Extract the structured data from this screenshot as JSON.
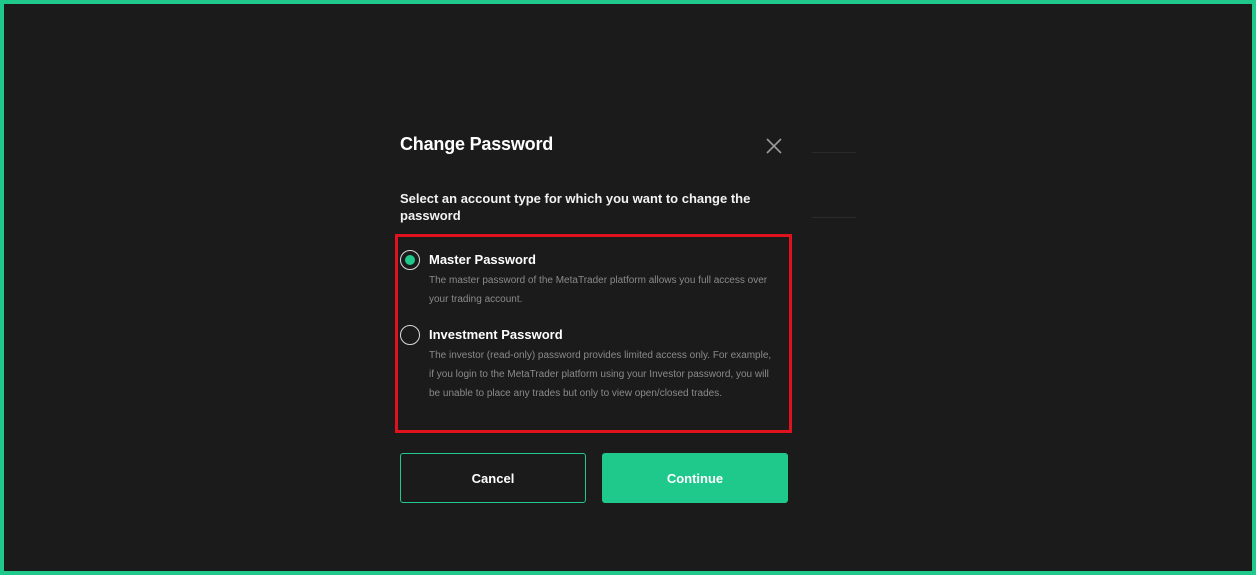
{
  "dialog": {
    "title": "Change Password",
    "close_icon": "close-icon",
    "prompt": "Select an account type for which you want to change the password",
    "options": [
      {
        "label": "Master Password",
        "description": "The master password of the MetaTrader platform allows you full access over your trading account.",
        "selected": true
      },
      {
        "label": "Investment Password",
        "description": "The investor (read-only) password provides limited access only. For example, if you login to the MetaTrader platform using your Investor password, you will be unable to place any trades but only to view open/closed trades.",
        "selected": false
      }
    ],
    "cancel_label": "Cancel",
    "continue_label": "Continue"
  },
  "colors": {
    "accent": "#1fc98b",
    "background": "#1b1b1b",
    "highlight_border": "#e0121d"
  }
}
